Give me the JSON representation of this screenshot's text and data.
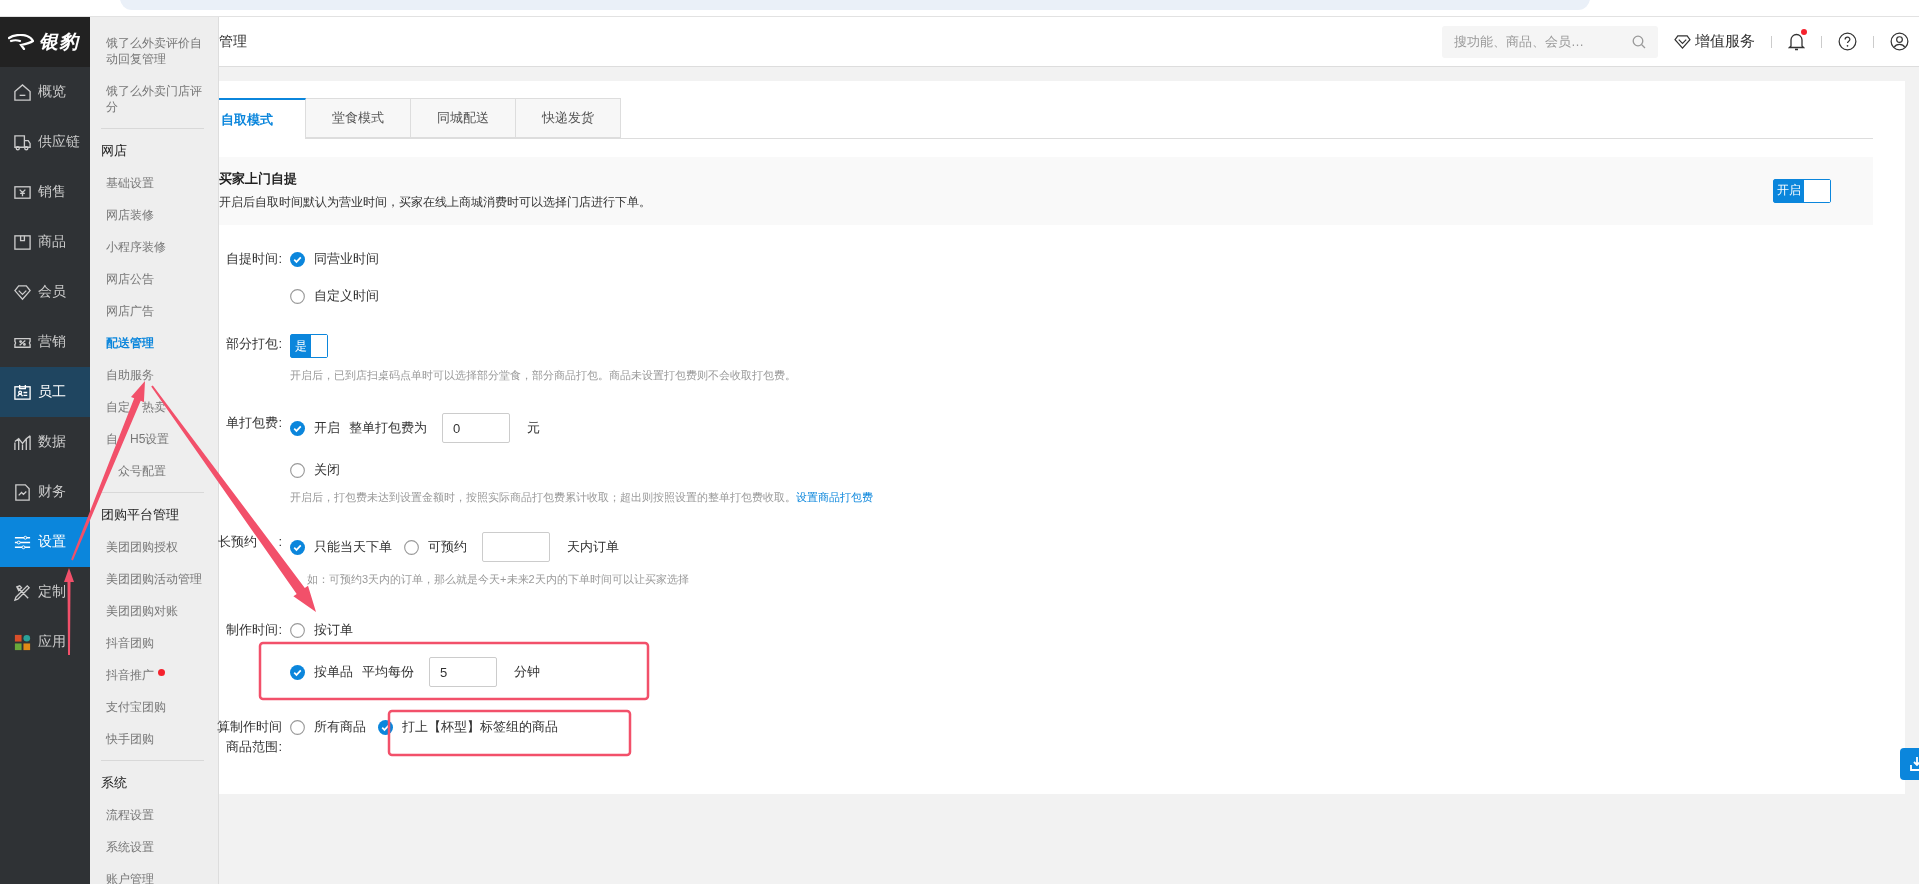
{
  "logo": {
    "text": "银豹"
  },
  "nav": [
    {
      "kind": "overview",
      "label": "概览",
      "selected": false,
      "hovered": false
    },
    {
      "kind": "supply",
      "label": "供应链",
      "selected": false,
      "hovered": false
    },
    {
      "kind": "sales",
      "label": "销售",
      "selected": false,
      "hovered": false
    },
    {
      "kind": "goods",
      "label": "商品",
      "selected": false,
      "hovered": false
    },
    {
      "kind": "member",
      "label": "会员",
      "selected": false,
      "hovered": false
    },
    {
      "kind": "marketing",
      "label": "营销",
      "selected": false,
      "hovered": false
    },
    {
      "kind": "staff",
      "label": "员工",
      "selected": false,
      "hovered": true
    },
    {
      "kind": "data",
      "label": "数据",
      "selected": false,
      "hovered": false
    },
    {
      "kind": "finance",
      "label": "财务",
      "selected": false,
      "hovered": false
    },
    {
      "kind": "settings",
      "label": "设置",
      "selected": true,
      "hovered": false
    },
    {
      "kind": "custom",
      "label": "定制",
      "selected": false,
      "hovered": false
    },
    {
      "kind": "apps",
      "label": "应用",
      "selected": false,
      "hovered": false
    }
  ],
  "subnav": [
    {
      "kind": "item",
      "label": "饿了么外卖评价自动回复管理",
      "selected": false
    },
    {
      "kind": "item",
      "label": "饿了么外卖门店评分",
      "selected": false
    },
    {
      "kind": "divider"
    },
    {
      "kind": "heading",
      "label": "网店"
    },
    {
      "kind": "item",
      "label": "基础设置",
      "selected": false
    },
    {
      "kind": "item",
      "label": "网店装修",
      "selected": false
    },
    {
      "kind": "item",
      "label": "小程序装修",
      "selected": false
    },
    {
      "kind": "item",
      "label": "网店公告",
      "selected": false
    },
    {
      "kind": "item",
      "label": "网店广告",
      "selected": false
    },
    {
      "kind": "item",
      "label": "配送管理",
      "selected": true
    },
    {
      "kind": "item",
      "label": "自助服务",
      "selected": false
    },
    {
      "kind": "item",
      "label": "自定",
      "label_after": "热卖",
      "selected": false
    },
    {
      "kind": "item",
      "label": "自",
      "label_after": "H5设置",
      "selected": false
    },
    {
      "kind": "item",
      "label": "众号配置",
      "lead_hidden": true,
      "selected": false
    },
    {
      "kind": "divider"
    },
    {
      "kind": "heading",
      "label": "团购平台管理"
    },
    {
      "kind": "item",
      "label": "美团团购授权",
      "selected": false
    },
    {
      "kind": "item",
      "label": "美团团购活动管理",
      "selected": false
    },
    {
      "kind": "item",
      "label": "美团团购对账",
      "selected": false
    },
    {
      "kind": "item",
      "label": "抖音团购",
      "selected": false
    },
    {
      "kind": "item",
      "label": "抖音推广",
      "selected": false,
      "dot": true
    },
    {
      "kind": "item",
      "label": "支付宝团购",
      "selected": false
    },
    {
      "kind": "item",
      "label": "快手团购",
      "selected": false
    },
    {
      "kind": "divider"
    },
    {
      "kind": "heading",
      "label": "系统"
    },
    {
      "kind": "item",
      "label": "流程设置",
      "selected": false
    },
    {
      "kind": "item",
      "label": "系统设置",
      "selected": false
    },
    {
      "kind": "item",
      "label": "账户管理",
      "selected": false
    }
  ],
  "header": {
    "title": "管理",
    "search": {
      "placeholder": "搜功能、商品、会员…"
    },
    "service": "增值服务",
    "notification_dot": true
  },
  "tabs": [
    {
      "label": "自取模式",
      "selected": true
    },
    {
      "label": "堂食模式",
      "selected": false
    },
    {
      "label": "同城配送",
      "selected": false
    },
    {
      "label": "快递发货",
      "selected": false
    }
  ],
  "notice": {
    "title": "买家上门自提",
    "text": "开启后自取时间默认为营业时间，买家在线上商城消费时可以选择门店进行下单。",
    "switch": {
      "label": "开启",
      "on": true
    }
  },
  "form": [
    {
      "kind": "choices-vertical",
      "label_lines": [
        "自提时间:"
      ],
      "options": [
        {
          "kind": "plain",
          "label": "同营业时间",
          "selected": true
        },
        {
          "kind": "plain",
          "label": "自定义时间",
          "selected": false
        }
      ]
    },
    {
      "kind": "toggle",
      "label_lines": [
        "部分打包:"
      ],
      "switch": {
        "label": "是",
        "on": true
      },
      "hint": {
        "text": "开启后，已到店扫桌码点单时可以选择部分堂食，部分商品打包。商品未设置打包费则不会收取打包费。"
      }
    },
    {
      "kind": "choices-vertical",
      "label_lines": [
        "单打包费:"
      ],
      "options": [
        {
          "kind": "input",
          "label": "开启",
          "selected": true,
          "extra": "整单打包费为",
          "value": "0",
          "unit": "元"
        },
        {
          "kind": "plain",
          "label": "关闭",
          "selected": false
        }
      ],
      "hint": {
        "text": "开启后，打包费未达到设置金额时，按照实际商品打包费累计收取；超出则按照设置的整单打包费收取。",
        "link": "设置商品打包费"
      }
    },
    {
      "kind": "choices-horizontal",
      "label_lines": [
        "长预约"
      ],
      "label_tail": ":",
      "options": [
        {
          "kind": "plain",
          "label": "只能当天下单",
          "selected": true
        },
        {
          "kind": "input",
          "label": "可预约",
          "selected": false,
          "unit": "天内订单"
        }
      ],
      "hint": {
        "lead_hidden": true,
        "text": "如：可预约3天内的订单，那么就是今天+未来2天内的下单时间可以让买家选择"
      }
    },
    {
      "kind": "choices-vertical",
      "label_lines": [
        "制作时间:"
      ],
      "options": [
        {
          "kind": "plain",
          "label": "按订单",
          "selected": false
        },
        {
          "kind": "input",
          "label": "按单品",
          "selected": true,
          "extra": "平均每份",
          "value": "5",
          "unit": "分钟"
        }
      ]
    },
    {
      "kind": "choices-horizontal",
      "label_lines": [
        "算制作时间",
        "商品范围:"
      ],
      "options": [
        {
          "kind": "plain",
          "label": "所有商品",
          "selected": false
        },
        {
          "kind": "plain",
          "label": "打上【杯型】标签组的商品",
          "selected": true
        }
      ]
    }
  ]
}
